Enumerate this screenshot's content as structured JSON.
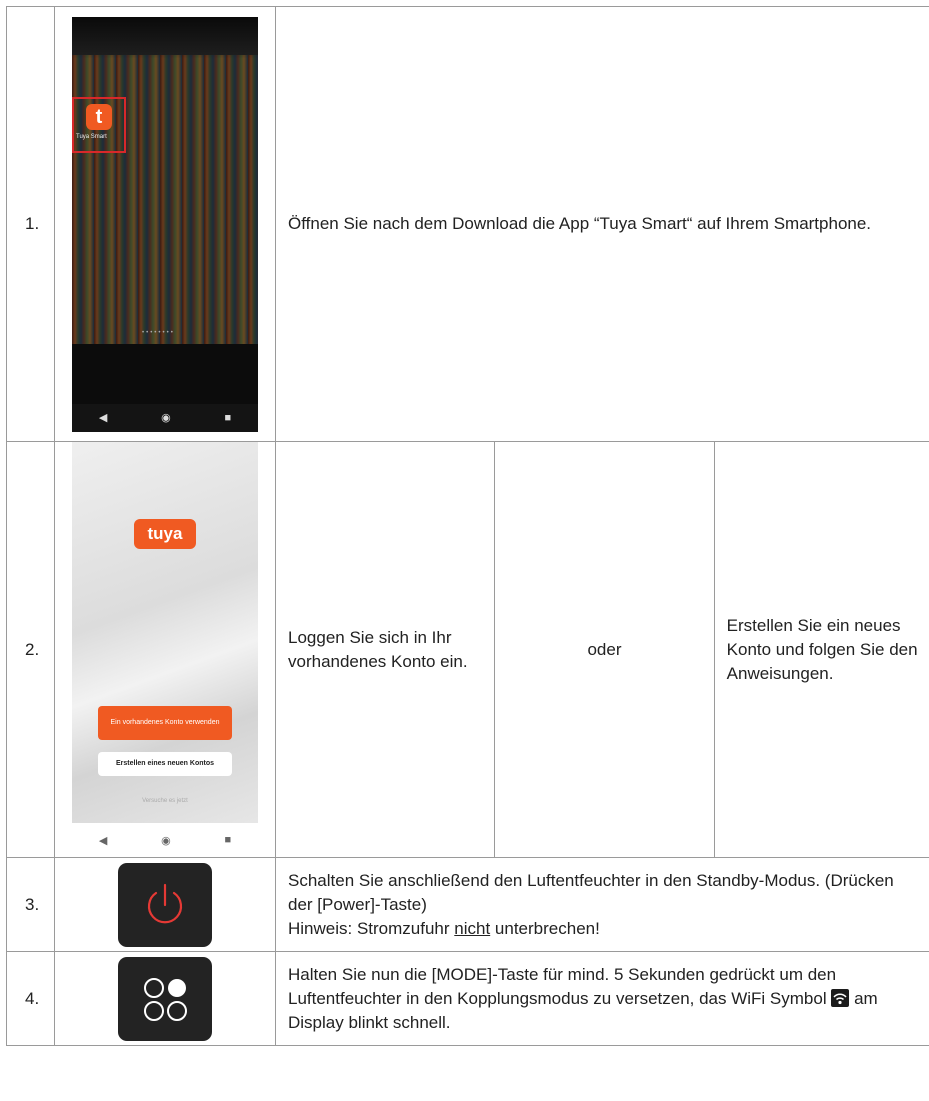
{
  "steps": [
    {
      "num": "1.",
      "text": "Öffnen Sie nach dem Download die App “Tuya Smart“ auf Ihrem Smartphone.",
      "phone": {
        "app_icon_letter": "t",
        "app_label": "Tuya Smart",
        "page_dots": "••••••••",
        "nav": [
          "◀",
          "◉",
          "■"
        ]
      }
    },
    {
      "num": "2.",
      "text_a": "Loggen Sie sich in Ihr vorhandenes Konto ein.",
      "or": "oder",
      "text_b": "Erstellen Sie ein neues Konto und folgen Sie den Anweisungen.",
      "phone": {
        "logo": "tuya",
        "login_button": "Ein vorhandenes Konto verwenden",
        "create_button": "Erstellen eines neuen Kontos",
        "later": "Versuche es jetzt",
        "nav": [
          "◀",
          "◉",
          "■"
        ]
      }
    },
    {
      "num": "3.",
      "line1": "Schalten Sie anschließend den Luftentfeuchter in den Standby-Modus. (Drücken der [Power]-Taste)",
      "hint_prefix": "Hinweis: Stromzufuhr ",
      "hint_underlined": "nicht",
      "hint_suffix": " unterbrechen!"
    },
    {
      "num": "4.",
      "text_before": "Halten Sie nun die [MODE]-Taste für mind. 5 Sekunden gedrückt um den Luftentfeuchter in den Kopplungsmodus zu versetzen, das WiFi Symbol ",
      "text_after": " am Display blinkt schnell."
    }
  ],
  "colors": {
    "tuya_orange": "#f05a22",
    "highlight_red": "#d8282a",
    "key_bg": "#232323",
    "power_red": "#e53935"
  }
}
